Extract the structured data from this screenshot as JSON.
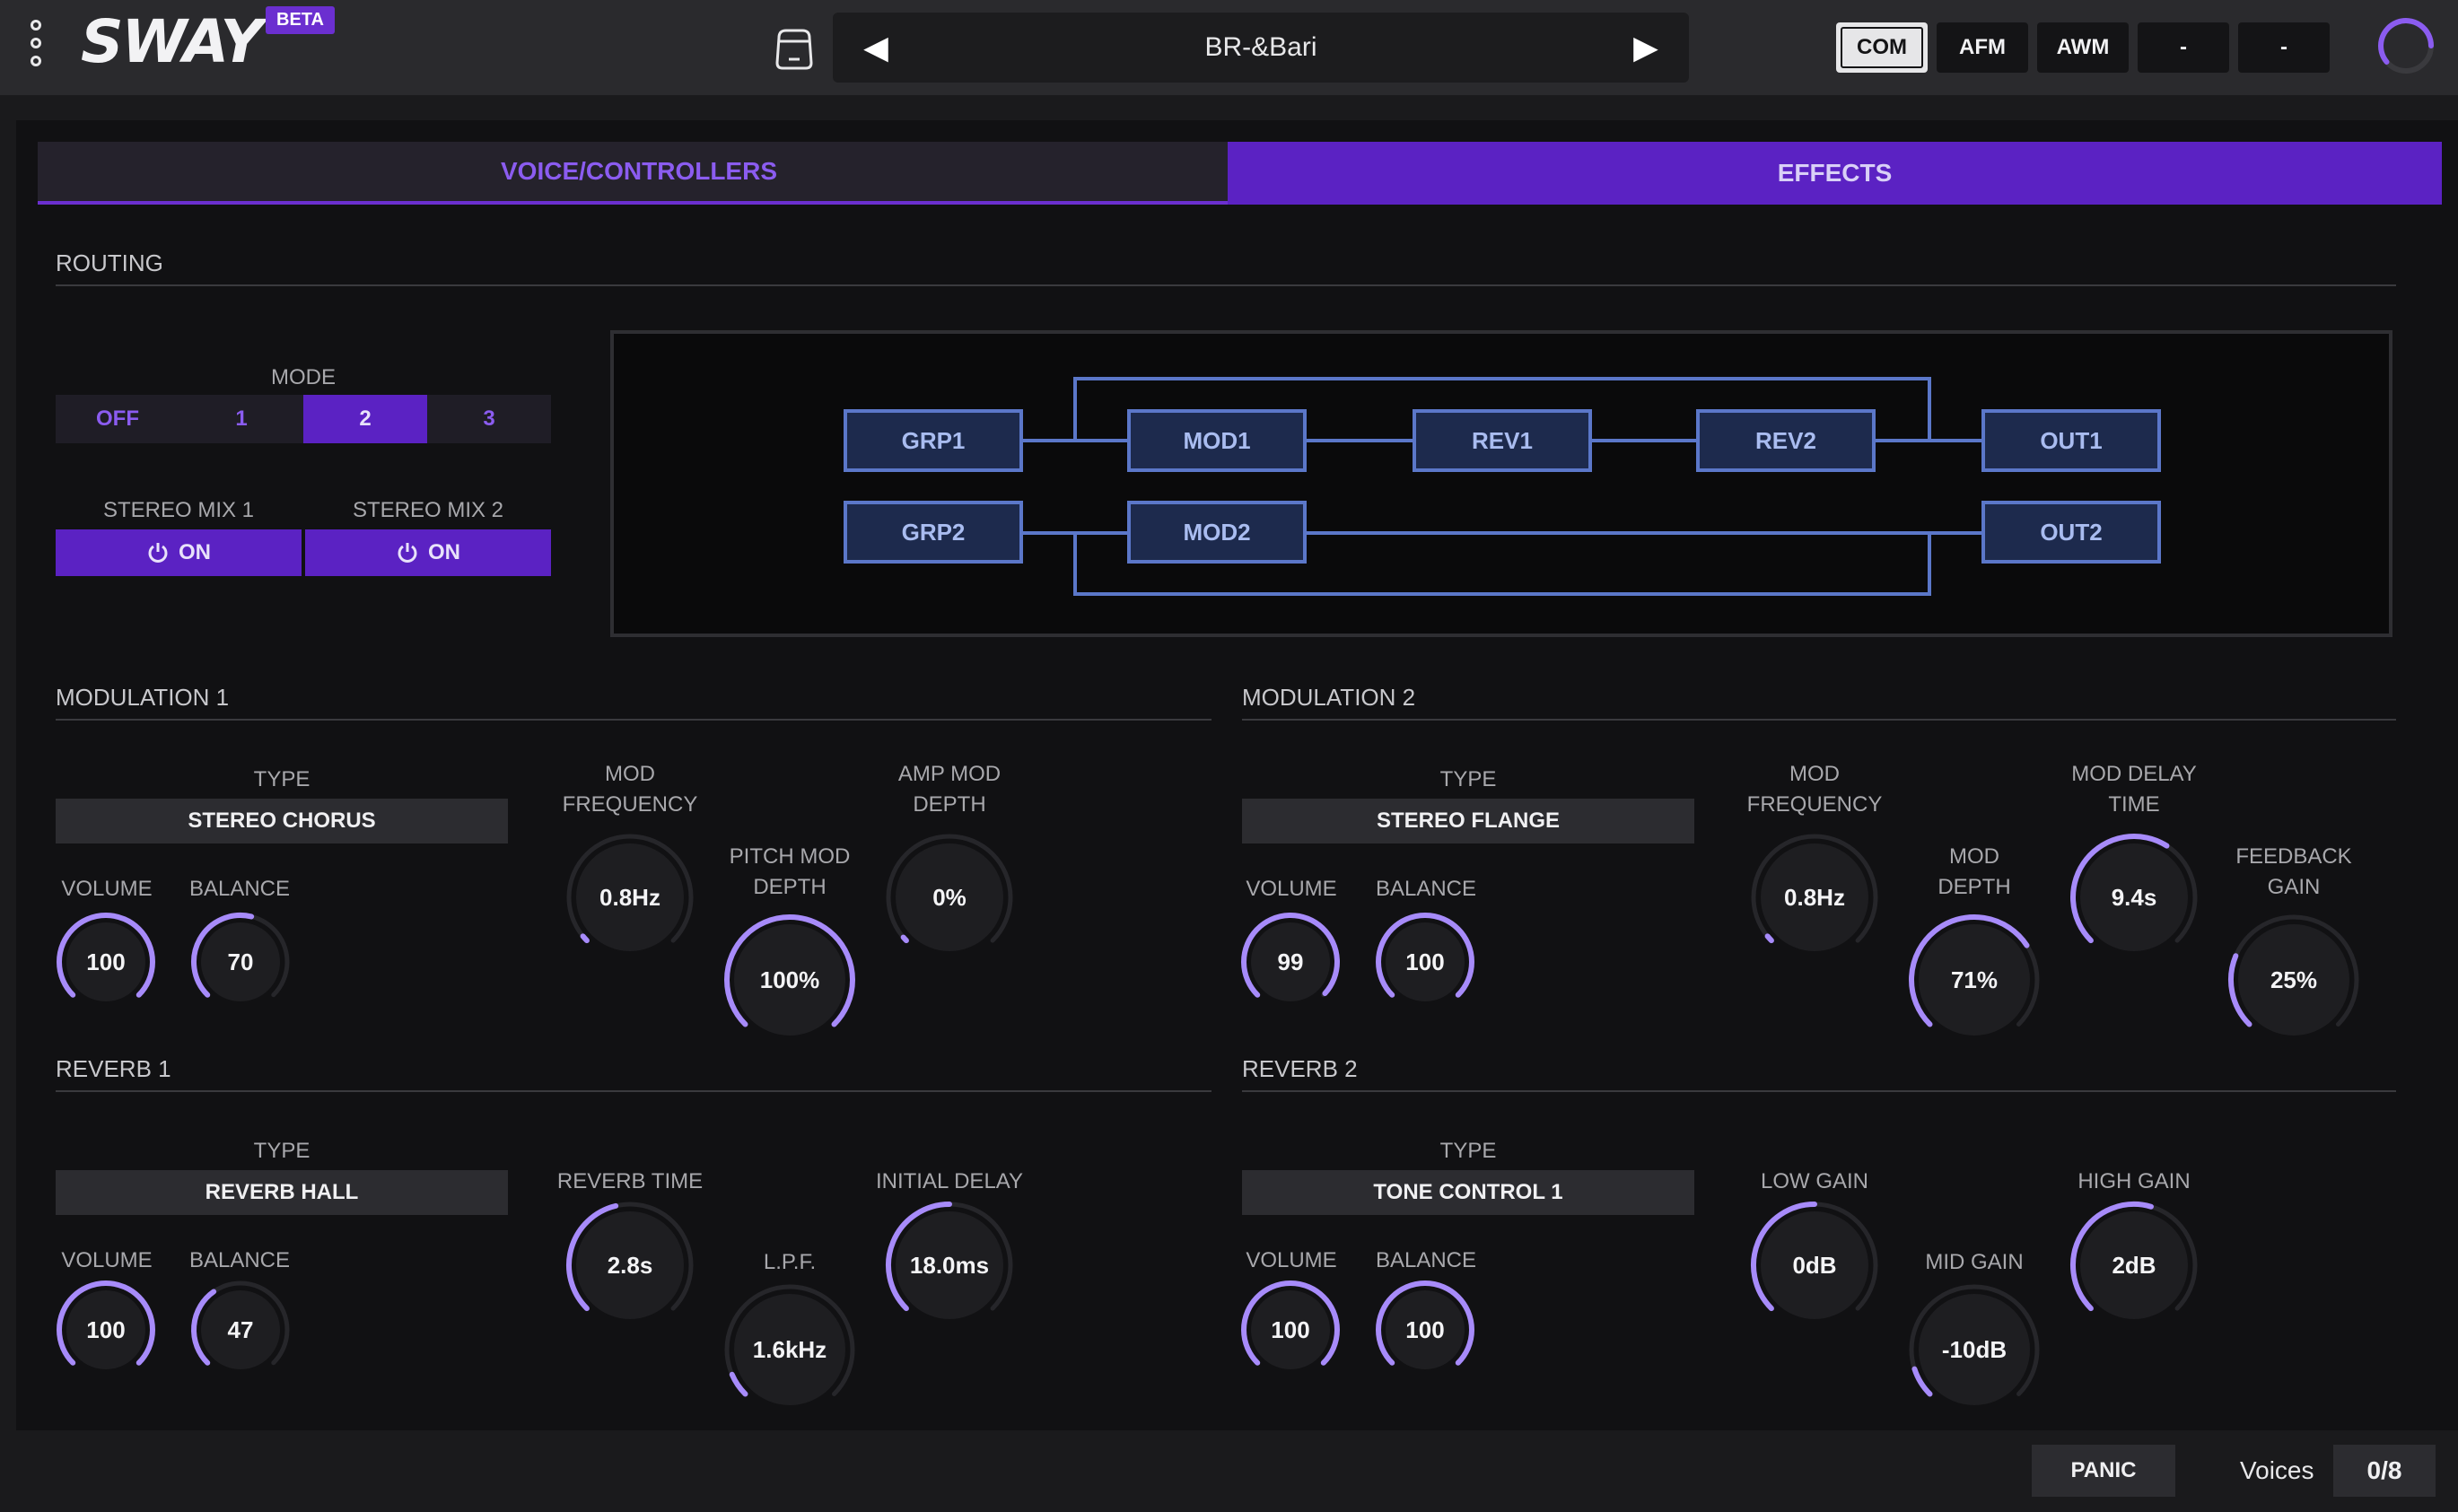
{
  "app": {
    "logo": "SWAY",
    "badge": "BETA"
  },
  "preset": {
    "name": "BR-&Bari",
    "prev": "◀",
    "next": "▶"
  },
  "engines": [
    {
      "label": "COM",
      "active": true
    },
    {
      "label": "AFM",
      "active": false
    },
    {
      "label": "AWM",
      "active": false
    },
    {
      "label": "-",
      "active": false
    },
    {
      "label": "-",
      "active": false
    }
  ],
  "tabs": {
    "voice": "VOICE/CONTROLLERS",
    "effects": "EFFECTS",
    "active": "effects"
  },
  "routing": {
    "title": "ROUTING",
    "mode_label": "MODE",
    "modes": [
      "OFF",
      "1",
      "2",
      "3"
    ],
    "mode_selected": "2",
    "stereo_mix1_label": "STEREO MIX 1",
    "stereo_mix2_label": "STEREO MIX 2",
    "stereo_mix1_state": "ON",
    "stereo_mix2_state": "ON",
    "nodes": {
      "grp1": "GRP1",
      "grp2": "GRP2",
      "mod1": "MOD1",
      "mod2": "MOD2",
      "rev1": "REV1",
      "rev2": "REV2",
      "out1": "OUT1",
      "out2": "OUT2"
    }
  },
  "labels": {
    "type": "TYPE",
    "volume": "VOLUME",
    "balance": "BALANCE",
    "mod_frequency_1": "MOD",
    "mod_frequency_2": "FREQUENCY",
    "pitch_mod_depth_1": "PITCH MOD",
    "pitch_mod_depth_2": "DEPTH",
    "amp_mod_depth_1": "AMP MOD",
    "amp_mod_depth_2": "DEPTH",
    "mod_depth_1": "MOD",
    "mod_depth_2": "DEPTH",
    "mod_delay_time_1": "MOD DELAY",
    "mod_delay_time_2": "TIME",
    "feedback_gain_1": "FEEDBACK",
    "feedback_gain_2": "GAIN",
    "reverb_time": "REVERB TIME",
    "lpf": "L.P.F.",
    "initial_delay": "INITIAL DELAY",
    "low_gain": "LOW GAIN",
    "mid_gain": "MID GAIN",
    "high_gain": "HIGH GAIN"
  },
  "modulation1": {
    "title": "MODULATION 1",
    "type": "STEREO CHORUS",
    "volume": "100",
    "volume_level": 1.0,
    "balance": "70",
    "balance_level": 0.55,
    "mod_frequency": "0.8Hz",
    "mod_frequency_level": 0.02,
    "pitch_mod_depth": "100%",
    "pitch_mod_depth_level": 1.0,
    "amp_mod_depth": "0%",
    "amp_mod_depth_level": 0.0
  },
  "modulation2": {
    "title": "MODULATION 2",
    "type": "STEREO FLANGE",
    "volume": "99",
    "volume_level": 0.99,
    "balance": "100",
    "balance_level": 1.0,
    "mod_frequency": "0.8Hz",
    "mod_frequency_level": 0.02,
    "mod_depth": "71%",
    "mod_depth_level": 0.71,
    "mod_delay_time": "9.4s",
    "mod_delay_time_level": 0.62,
    "feedback_gain": "25%",
    "feedback_gain_level": 0.25
  },
  "reverb1": {
    "title": "REVERB 1",
    "type": "REVERB HALL",
    "volume": "100",
    "volume_level": 1.0,
    "balance": "47",
    "balance_level": 0.37,
    "reverb_time": "2.8s",
    "reverb_time_level": 0.45,
    "lpf": "1.6kHz",
    "lpf_level": 0.08,
    "initial_delay": "18.0ms",
    "initial_delay_level": 0.5
  },
  "reverb2": {
    "title": "REVERB 2",
    "type": "TONE CONTROL 1",
    "volume": "100",
    "volume_level": 1.0,
    "balance": "100",
    "balance_level": 1.0,
    "low_gain": "0dB",
    "low_gain_level": 0.5,
    "mid_gain": "-10dB",
    "mid_gain_level": 0.1,
    "high_gain": "2dB",
    "high_gain_level": 0.56
  },
  "footer": {
    "panic": "PANIC",
    "voices_label": "Voices",
    "voices_value": "0/8"
  },
  "colors": {
    "accent": "#6b2fd0",
    "knob_arc": "#a78bfa",
    "node_border": "#5b77c9"
  },
  "icons": {
    "menu": "vertical-dots-icon",
    "preset": "bank-icon",
    "power": "power-icon",
    "load": "load-ring-icon"
  }
}
